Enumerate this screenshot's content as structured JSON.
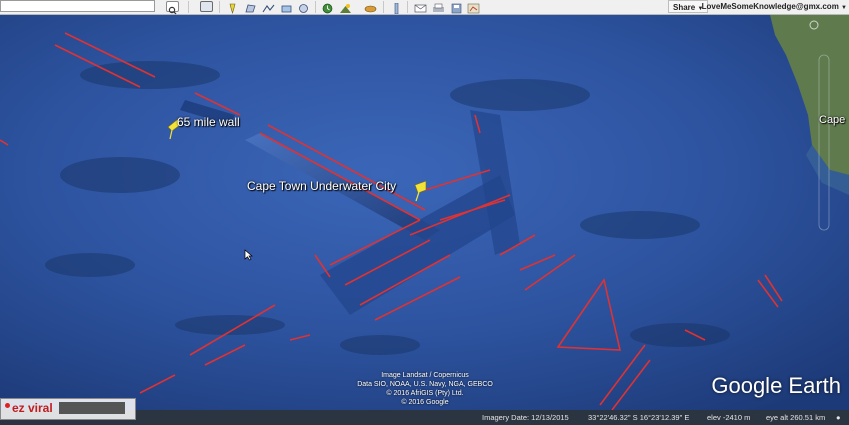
{
  "toolbar": {
    "share_label": "Share",
    "account_email": "LoveMeSomeKnowledge@gmx.com",
    "icons": [
      "search-icon",
      "sidebar-icon",
      "placemark-icon",
      "polygon-icon",
      "path-icon",
      "overlay-icon",
      "tour-icon",
      "historical-imagery-icon",
      "sun-icon",
      "planets-icon",
      "ruler-icon",
      "email-icon",
      "print-icon",
      "save-image-icon",
      "maps-icon"
    ]
  },
  "map": {
    "labels": {
      "wall": "65 mile wall",
      "city": "Cape Town Underwater City",
      "coast": "Cape"
    },
    "credits": [
      "Image Landsat / Copernicus",
      "Data SIO, NOAA, U.S. Navy, NGA, GEBCO",
      "© 2016 AfriGIS (Pty) Ltd.",
      "© 2016 Google"
    ],
    "logo": "Google Earth",
    "colors": {
      "ocean": "#2a4f9e",
      "annotation": "#e03232",
      "land": "#5f7a4d",
      "pin": "#f2e23a"
    }
  },
  "status": {
    "imagery_date": "Imagery Date: 12/13/2015",
    "coordinates": "33°22'46.32\" S    16°23'12.39\" E",
    "elevation": "elev -2410 m",
    "eye_alt": "eye alt 260.51 km"
  },
  "watermark": {
    "text": "ez viral"
  }
}
